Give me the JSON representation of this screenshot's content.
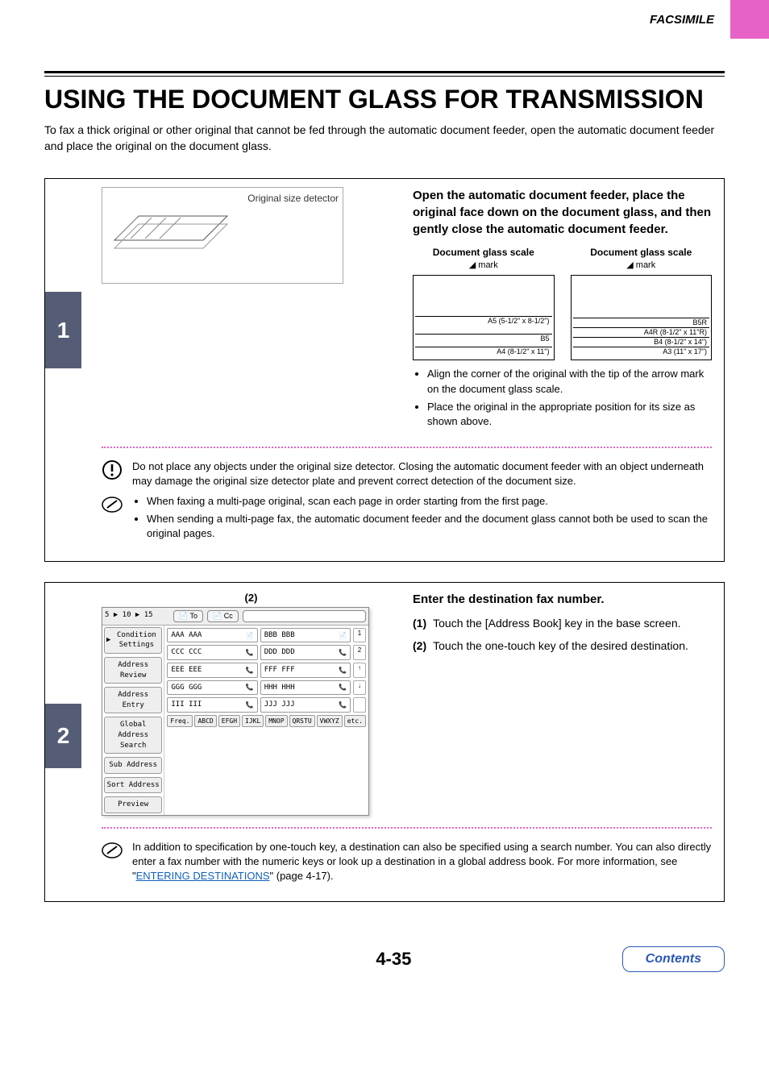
{
  "header": {
    "section_label": "FACSIMILE"
  },
  "title": "USING THE DOCUMENT GLASS FOR TRANSMISSION",
  "intro": "To fax a thick original or other original that cannot be fed through the automatic document feeder, open the automatic document feeder and place the original on the document glass.",
  "step1": {
    "number": "1",
    "diagram_label": "Original size detector",
    "heading": "Open the automatic document feeder, place the original face down on the document glass, and then gently close the automatic document feeder.",
    "scale_a": {
      "title": "Document glass scale",
      "mark": "mark",
      "rows": [
        "A5 (5-1/2\" x 8-1/2\")",
        "B5",
        "A4 (8-1/2\" x 11\")"
      ]
    },
    "scale_b": {
      "title": "Document glass scale",
      "mark": "mark",
      "rows": [
        "B5R",
        "A4R (8-1/2\" x 11\"R)",
        "B4 (8-1/2\" x 14\")",
        "A3 (11\" x 17\")"
      ]
    },
    "bullets": [
      "Align the corner of the original with the tip of the arrow mark on the document glass scale.",
      "Place the original in the appropriate position for its size as shown above."
    ],
    "caution": "Do not place any objects under the original size detector. Closing the automatic document feeder with an object underneath may damage the original size detector plate and prevent correct detection of the document size.",
    "notes": [
      "When faxing a multi-page original, scan each page in order starting from the first page.",
      "When sending a multi-page fax, the automatic document feeder and the document glass cannot both be used to scan the original pages."
    ]
  },
  "step2": {
    "number": "2",
    "callout": "(2)",
    "heading": "Enter the destination fax number.",
    "substeps": [
      {
        "n": "(1)",
        "t": "Touch the [Address Book] key in the base screen."
      },
      {
        "n": "(2)",
        "t": "Touch the one-touch key of the desired destination."
      }
    ],
    "panel": {
      "toolbar": "5 ▶ 10 ▶ 15",
      "to": "To",
      "cc": "Cc",
      "side": [
        "Condition Settings",
        "Address Review",
        "Address Entry",
        "Global Address Search",
        "Sub Address",
        "Sort Address",
        "Preview"
      ],
      "tiles": [
        [
          "AAA AAA",
          "BBB BBB"
        ],
        [
          "CCC CCC",
          "DDD DDD"
        ],
        [
          "EEE EEE",
          "FFF FFF"
        ],
        [
          "GGG GGG",
          "HHH HHH"
        ],
        [
          "III III",
          "JJJ JJJ"
        ]
      ],
      "side_nums": [
        "1",
        "2",
        "↑",
        "↓"
      ],
      "tabs": [
        "Freq.",
        "ABCD",
        "EFGH",
        "IJKL",
        "MNOP",
        "QRSTU",
        "VWXYZ",
        "etc."
      ]
    },
    "note_text_pre": "In addition to specification by one-touch key, a destination can also be specified using a search number. You can also directly enter a fax number with the numeric keys or look up a destination in a global address book. For more information, see \"",
    "note_link": "ENTERING DESTINATIONS",
    "note_text_post": "\" (page 4-17)."
  },
  "footer": {
    "page": "4-35",
    "contents": "Contents"
  }
}
